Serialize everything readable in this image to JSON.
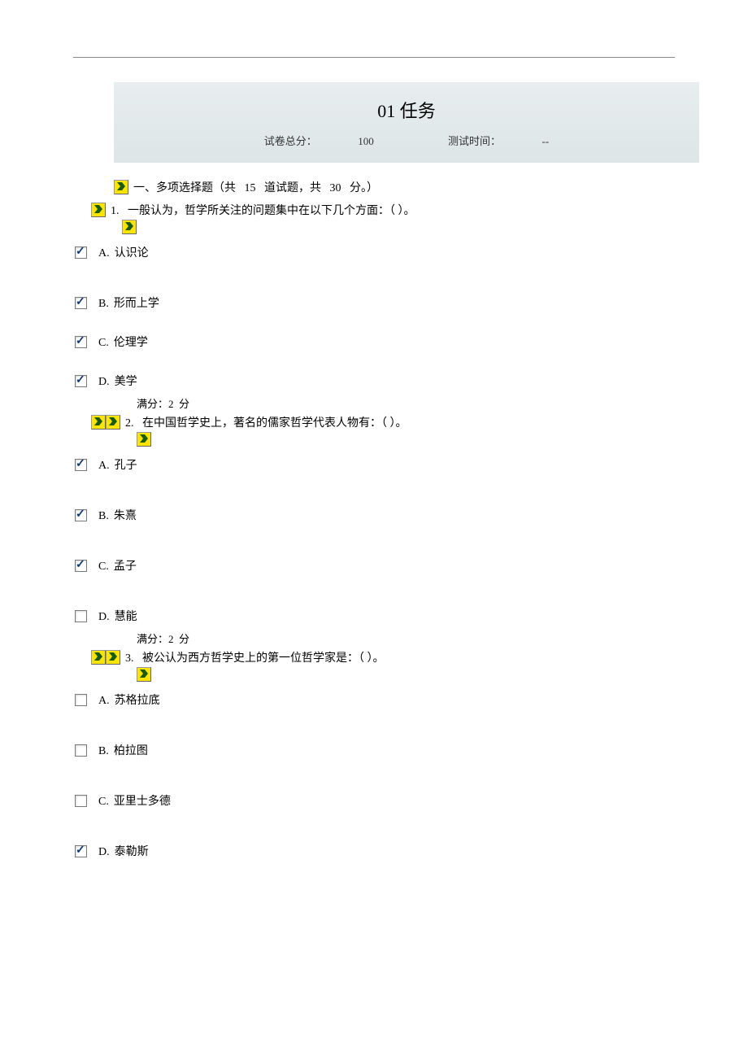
{
  "header": {
    "title": "01 任务",
    "score_label": "试卷总分：",
    "score_value": "100",
    "time_label": "测试时间：",
    "time_value": "--"
  },
  "section": {
    "text_pre": "一、多项选择题（共",
    "count": "15",
    "text_mid": "道试题，共",
    "points": "30",
    "text_end": "分。）"
  },
  "questions": [
    {
      "num": "1.",
      "text": "一般认为，哲学所关注的问题集中在以下几个方面：（                            ）。",
      "options": [
        {
          "letter": "A.",
          "text": "认识论",
          "checked": true
        },
        {
          "letter": "B.",
          "text": "形而上学",
          "checked": true
        },
        {
          "letter": "C.",
          "text": "伦理学",
          "checked": true
        },
        {
          "letter": "D.",
          "text": "美学",
          "checked": true
        }
      ],
      "score_pre": "满分：",
      "score_val": "2",
      "score_suf": "分"
    },
    {
      "num": "2.",
      "text": "在中国哲学史上，著名的儒家哲学代表人物有：（                            ）。",
      "options": [
        {
          "letter": "A.",
          "text": "孔子",
          "checked": true
        },
        {
          "letter": "B.",
          "text": "朱熹",
          "checked": true
        },
        {
          "letter": "C.",
          "text": "孟子",
          "checked": true
        },
        {
          "letter": "D.",
          "text": "慧能",
          "checked": false
        }
      ],
      "score_pre": "满分：",
      "score_val": "2",
      "score_suf": "分"
    },
    {
      "num": "3.",
      "text": "被公认为西方哲学史上的第一位哲学家是：（                            ）。",
      "options": [
        {
          "letter": "A.",
          "text": "苏格拉底",
          "checked": false
        },
        {
          "letter": "B.",
          "text": "柏拉图",
          "checked": false
        },
        {
          "letter": "C.",
          "text": "亚里士多德",
          "checked": false
        },
        {
          "letter": "D.",
          "text": "泰勒斯",
          "checked": true
        }
      ],
      "score_pre": "",
      "score_val": "",
      "score_suf": ""
    }
  ]
}
